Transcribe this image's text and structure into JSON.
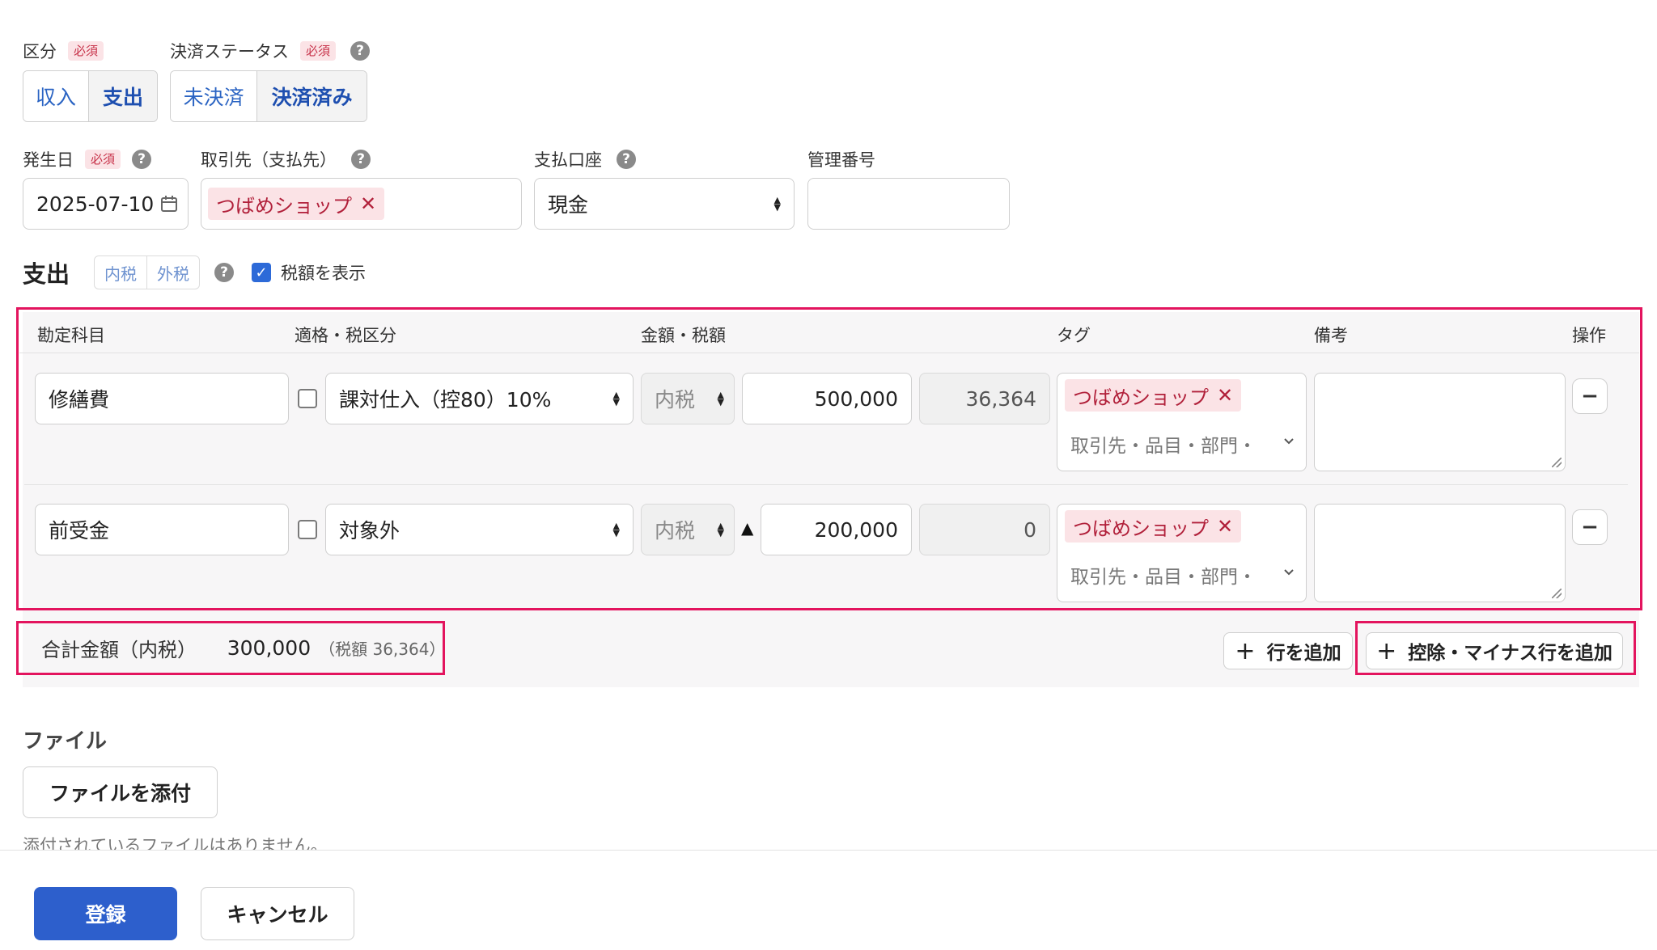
{
  "category": {
    "label": "区分",
    "required": "必須",
    "options": [
      "収入",
      "支出"
    ],
    "selected": "支出"
  },
  "settlement": {
    "label": "決済ステータス",
    "required": "必須",
    "options": [
      "未決済",
      "決済済み"
    ],
    "selected": "決済済み"
  },
  "date": {
    "label": "発生日",
    "required": "必須",
    "value": "2025-07-10"
  },
  "partner": {
    "label": "取引先（支払先）",
    "chip": "つばめショップ"
  },
  "account": {
    "label": "支払口座",
    "value": "現金"
  },
  "mgmt": {
    "label": "管理番号",
    "value": ""
  },
  "expense": {
    "title": "支出",
    "tax_modes": [
      "内税",
      "外税"
    ],
    "show_tax_label": "税額を表示",
    "show_tax_checked": true
  },
  "table": {
    "headers": [
      "勘定科目",
      "適格・税区分",
      "金額・税額",
      "タグ",
      "備考",
      "操作"
    ],
    "rows": [
      {
        "account": "修繕費",
        "tax_category": "課対仕入（控80）10%",
        "tax_mode": "内税",
        "minus_mark": "",
        "amount": "500,000",
        "tax": "36,364",
        "tag_chip": "つばめショップ",
        "tag_placeholder": "取引先・品目・部門・",
        "memo": ""
      },
      {
        "account": "前受金",
        "tax_category": "対象外",
        "tax_mode": "内税",
        "minus_mark": "▲",
        "amount": "200,000",
        "tax": "0",
        "tag_chip": "つばめショップ",
        "tag_placeholder": "取引先・品目・部門・",
        "memo": ""
      }
    ]
  },
  "total": {
    "label": "合計金額（内税）",
    "amount": "300,000",
    "tax_note": "（税額 36,364）"
  },
  "buttons": {
    "add_row": "行を追加",
    "add_minus_row": "控除・マイナス行を追加",
    "submit": "登録",
    "cancel": "キャンセル"
  },
  "files": {
    "title": "ファイル",
    "attach": "ファイルを添付",
    "empty": "添付されているファイルはありません。"
  },
  "colors": {
    "highlight": "#e3145e",
    "primary": "#2d5fcc",
    "chip_bg": "#fbe3e6",
    "chip_text": "#b1203a"
  }
}
